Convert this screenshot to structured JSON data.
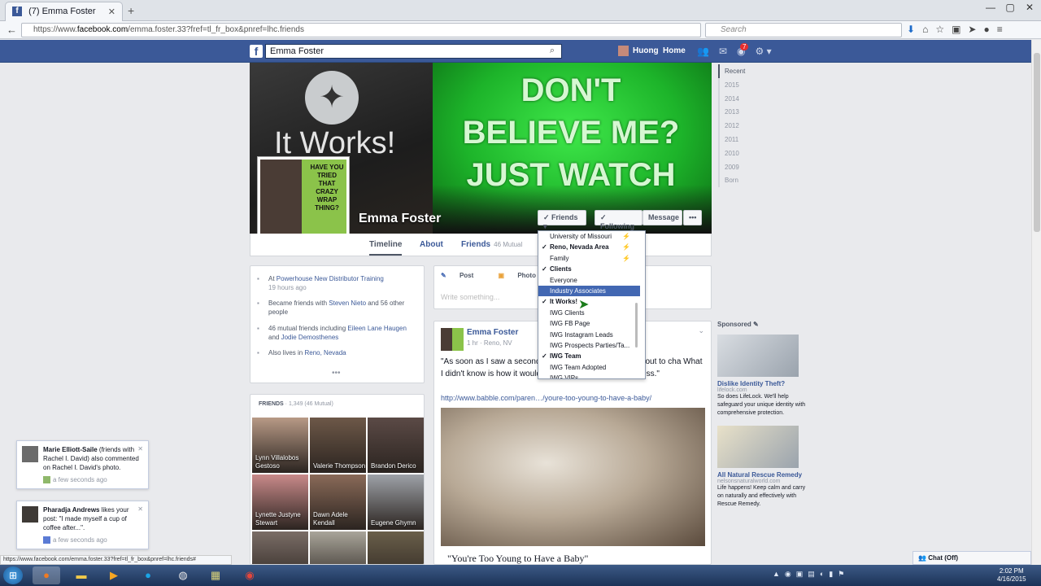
{
  "browser": {
    "tab_title": "(7) Emma Foster",
    "tab_close": "✕",
    "new_tab": "+",
    "url_prefix": "https://www.",
    "url_domain": "facebook.com",
    "url_rest": "/emma.foster.33?fref=tl_fr_box&pnref=lhc.friends",
    "search_placeholder": "Search",
    "window_buttons": [
      "—",
      "▢",
      "✕"
    ]
  },
  "fb": {
    "logo": "f",
    "search_value": "Emma Foster",
    "user_name": "Huong",
    "home": "Home",
    "notif_count": "7"
  },
  "cover": {
    "brand_text": "It Works!",
    "headline": "DON'T BELIEVE ME? JUST WATCH",
    "profile_pic_text": "HAVE YOU TRIED THAT CRAZY WRAP THING?"
  },
  "profile": {
    "name": "Emma Foster",
    "friends_btn": "✓ Friends ▾",
    "following_btn": "✓ Following",
    "message_btn": "Message",
    "more_btn": "•••",
    "tabs": [
      {
        "label": "Timeline"
      },
      {
        "label": "About"
      },
      {
        "label": "Friends",
        "sub": "46 Mutual"
      }
    ]
  },
  "intro": {
    "work_prefix": "At ",
    "work_link": "Powerhouse New Distributor Training",
    "work_time": "19 hours ago",
    "friends_prefix": "Became friends with ",
    "friends_link": "Steven Nieto",
    "friends_suffix": " and 56 other people",
    "mutual_prefix": "46 mutual friends including ",
    "mutual_link1": "Eileen Lane Haugen",
    "mutual_and": " and ",
    "mutual_link2": "Jodie Demosthenes",
    "lives_prefix": "Also lives in ",
    "lives_link": "Reno, Nevada",
    "more": "•••"
  },
  "friends_box": {
    "title": "FRIENDS",
    "count": " · 1,349 (46 Mutual)",
    "people": [
      {
        "name": "Lynn Villalobos Gestoso",
        "color": "#b89a86"
      },
      {
        "name": "Valerie Thompson",
        "color": "#6d5848"
      },
      {
        "name": "Brandon Derico",
        "color": "#5b4a46"
      },
      {
        "name": "Lynette Justyne Stewart",
        "color": "#c98a8a"
      },
      {
        "name": "Dawn Adele Kendall",
        "color": "#8a6a58"
      },
      {
        "name": "Eugene Ghymn",
        "color": "#9ea2a8"
      },
      {
        "name": "",
        "color": "#7a6d66"
      },
      {
        "name": "",
        "color": "#a9a59a"
      },
      {
        "name": "",
        "color": "#6a5f4a"
      }
    ]
  },
  "composer": {
    "post": "Post",
    "photo": "Photo / Video",
    "write": "Write something..."
  },
  "post": {
    "author": "Emma Foster",
    "meta": "1 hr · Reno, NV",
    "text": "\"As soon as I saw a second                                    knew that everything was about to cha                           What I didn't know is how it would change me, too, in the process.\"",
    "link": "http://www.babble.com/paren…/youre-too-young-to-have-a-baby/",
    "title": "\"You're Too Young to Have a Baby\""
  },
  "timeline_nav": [
    "Recent",
    "2015",
    "2014",
    "2013",
    "2012",
    "2011",
    "2010",
    "2009",
    "Born"
  ],
  "sponsored": {
    "header": "Sponsored",
    "ads": [
      {
        "title": "Dislike Identity Theft?",
        "source": "lifelock.com",
        "desc": "So does LifeLock. We'll help safeguard your unique identity with comprehensive protection.",
        "color": "#d9dde2"
      },
      {
        "title": "All Natural Rescue Remedy",
        "source": "nelsonsnaturalworld.com",
        "desc": "Life happens! Keep calm and carry on naturally and effectively with Rescue Remedy.",
        "color": "#e8e1c9"
      }
    ]
  },
  "dropdown": {
    "items": [
      {
        "label": "University of Missouri",
        "checked": false,
        "bold": false,
        "lock": true
      },
      {
        "label": "Reno, Nevada Area",
        "checked": true,
        "bold": true,
        "lock": true
      },
      {
        "label": "Family",
        "checked": false,
        "bold": false,
        "lock": true
      },
      {
        "label": "Clients",
        "checked": true,
        "bold": true,
        "lock": false
      },
      {
        "label": "Everyone",
        "checked": false,
        "bold": false,
        "lock": false
      },
      {
        "label": "Industry Associates",
        "checked": false,
        "bold": false,
        "lock": false,
        "highlight": true
      },
      {
        "label": "It Works!",
        "checked": true,
        "bold": true,
        "lock": false
      },
      {
        "label": "IWG Clients",
        "checked": false,
        "bold": false,
        "lock": false
      },
      {
        "label": "IWG FB Page",
        "checked": false,
        "bold": false,
        "lock": false
      },
      {
        "label": "IWG Instagram Leads",
        "checked": false,
        "bold": false,
        "lock": false
      },
      {
        "label": "IWG Prospects Parties/Ta...",
        "checked": false,
        "bold": false,
        "lock": false
      },
      {
        "label": "IWG Team",
        "checked": true,
        "bold": true,
        "lock": false
      },
      {
        "label": "IWG Team Adopted",
        "checked": false,
        "bold": false,
        "lock": false
      },
      {
        "label": "IWG VIPs",
        "checked": false,
        "bold": false,
        "lock": false
      }
    ]
  },
  "notifications": [
    {
      "html_name": "Marie Elliott-Saile",
      "text": " (friends with Rachel I. David) also commented on Rachel I. David's photo.",
      "time": "a few seconds ago"
    },
    {
      "html_name": "Pharadja Andrews",
      "text": " likes your post: \"I made myself a cup of coffee after...\".",
      "time": "a few seconds ago"
    }
  ],
  "status_url": "https://www.facebook.com/emma.foster.33?fref=tl_fr_box&pnref=lhc.friends#",
  "chat": "Chat (Off)",
  "clock": {
    "time": "2:02 PM",
    "date": "4/16/2015"
  }
}
